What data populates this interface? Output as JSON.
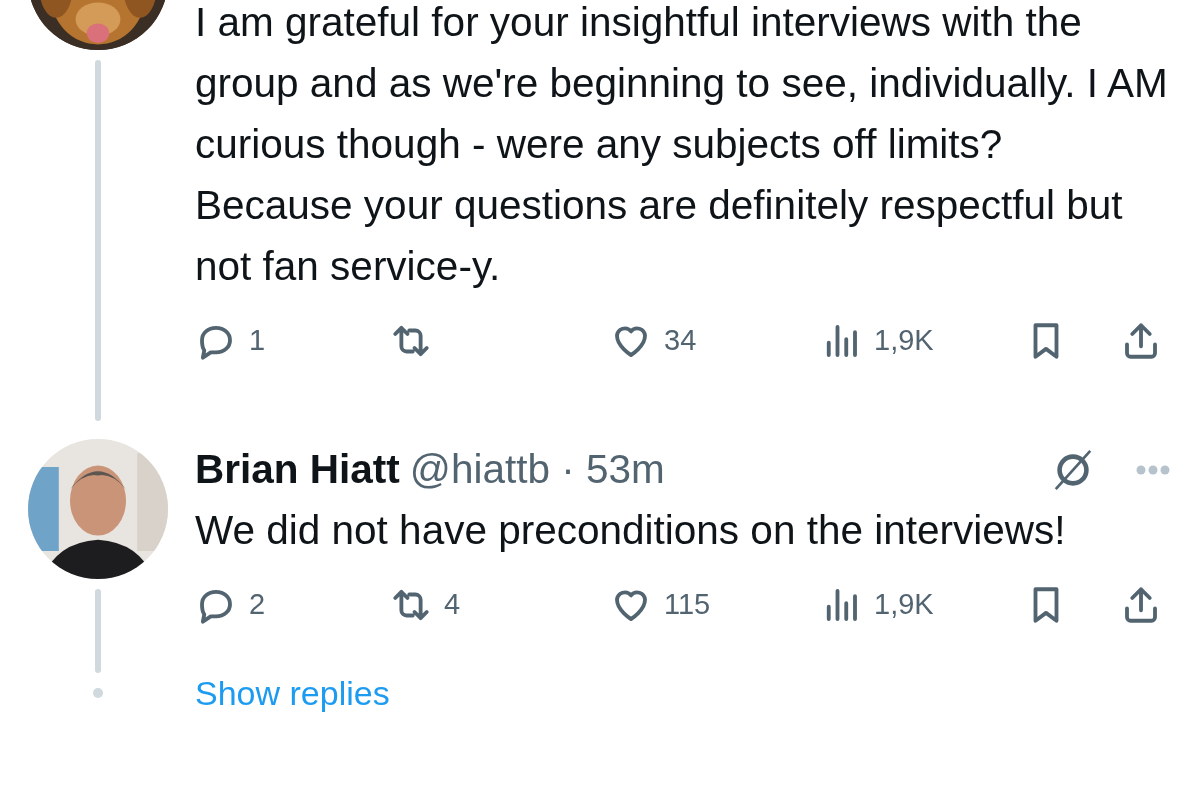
{
  "tweets": [
    {
      "avatar": {
        "kind": "dog"
      },
      "body": "I am grateful for your insightful interviews with the group and as we're beginning to see, individually.  I AM curious though - were any subjects off limits?  Because your questions are definitely respectful but not fan service-y.",
      "actions": {
        "replies": "1",
        "likes": "34",
        "views": "1,9K"
      }
    },
    {
      "avatar": {
        "kind": "person"
      },
      "name": "Brian Hiatt",
      "handle": "@hiattb",
      "separator": "·",
      "time": "53m",
      "grok": true,
      "body": "We did not have preconditions on the interviews!",
      "actions": {
        "replies": "2",
        "reposts": "4",
        "likes": "115",
        "views": "1,9K"
      }
    }
  ],
  "show_replies": "Show replies"
}
